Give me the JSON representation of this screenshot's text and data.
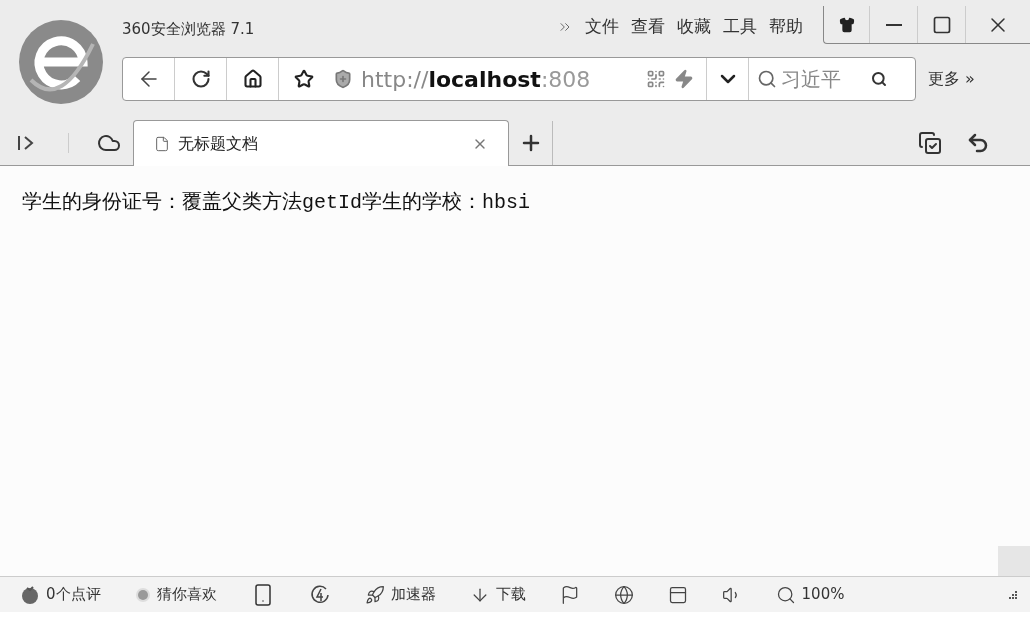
{
  "window": {
    "title": "360安全浏览器 7.1"
  },
  "menu": [
    {
      "label": "文件"
    },
    {
      "label": "查看"
    },
    {
      "label": "收藏"
    },
    {
      "label": "工具"
    },
    {
      "label": "帮助"
    }
  ],
  "address_bar": {
    "scheme": "http://",
    "host": "localhost",
    "port": ":808"
  },
  "search": {
    "placeholder": "习近平"
  },
  "more_button": "更多 »",
  "tabs": [
    {
      "label": "无标题文档",
      "selected": true
    }
  ],
  "content": {
    "text": "学生的身份证号：覆盖父类方法getId学生的学校：hbsi"
  },
  "status_bar": [
    {
      "kind": "reviews",
      "label": "0个点评"
    },
    {
      "kind": "guess",
      "label": "猜你喜欢"
    },
    {
      "kind": "phone"
    },
    {
      "kind": "speed"
    },
    {
      "kind": "accelerator",
      "label": "加速器"
    },
    {
      "kind": "download",
      "label": "下载"
    },
    {
      "kind": "flag"
    },
    {
      "kind": "ie"
    },
    {
      "kind": "window"
    },
    {
      "kind": "sound"
    },
    {
      "kind": "zoom",
      "label": "100%"
    }
  ]
}
